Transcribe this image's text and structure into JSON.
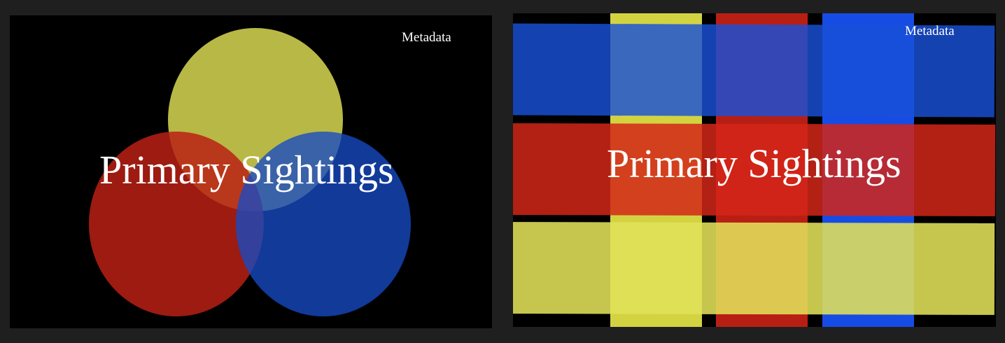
{
  "slides": [
    {
      "name": "venn-slide",
      "metadata_label": "Metadata",
      "title": "Primary Sightings",
      "colors": {
        "background": "#000000",
        "yellow": "#c4c44a",
        "red": "#b8261a",
        "blue": "#1448c4"
      }
    },
    {
      "name": "grid-slide",
      "metadata_label": "Metadata",
      "title": "Primary Sightings",
      "colors": {
        "background": "#000000",
        "blue": "#1448d0",
        "red": "#c0261a",
        "yellow": "#d8d850"
      }
    }
  ]
}
